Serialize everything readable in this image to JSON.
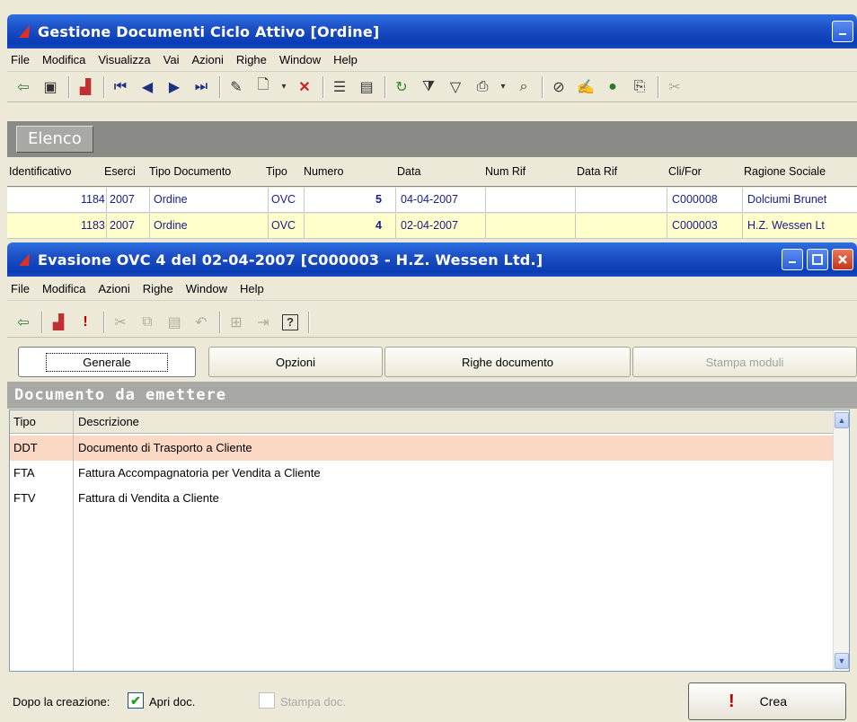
{
  "main": {
    "title": "Gestione Documenti Ciclo Attivo [Ordine]",
    "menu": [
      "File",
      "Modifica",
      "Visualizza",
      "Vai",
      "Azioni",
      "Righe",
      "Window",
      "Help"
    ],
    "elenco_label": "Elenco",
    "columns": [
      "Identificativo",
      "Eserci",
      "Tipo Documento",
      "Tipo",
      "Numero",
      "Data",
      "Num Rif",
      "Data Rif",
      "Cli/For",
      "Ragione Sociale"
    ],
    "rows": [
      {
        "id": "1184",
        "esercizio": "2007",
        "tipo_documento": "Ordine",
        "tipo": "OVC",
        "numero": "5",
        "data": "04-04-2007",
        "num_rif": "",
        "data_rif": "",
        "cli_for": "C000008",
        "ragione_sociale": "Dolciumi Brunet"
      },
      {
        "id": "1183",
        "esercizio": "2007",
        "tipo_documento": "Ordine",
        "tipo": "OVC",
        "numero": "4",
        "data": "02-04-2007",
        "num_rif": "",
        "data_rif": "",
        "cli_for": "C000003",
        "ragione_sociale": "H.Z. Wessen Lt"
      }
    ]
  },
  "dialog": {
    "title": "Evasione OVC 4 del 02-04-2007 [C000003 - H.Z. Wessen Ltd.]",
    "menu": [
      "File",
      "Modifica",
      "Azioni",
      "Righe",
      "Window",
      "Help"
    ],
    "tabs": [
      "Generale",
      "Opzioni",
      "Righe documento",
      "Stampa moduli"
    ],
    "section_title": "Documento da emettere",
    "list_columns": [
      "Tipo",
      "Descrizione"
    ],
    "list_rows": [
      {
        "tipo": "DDT",
        "descrizione": "Documento di Trasporto a Cliente"
      },
      {
        "tipo": "FTA",
        "descrizione": "Fattura Accompagnatoria per Vendita a Cliente"
      },
      {
        "tipo": "FTV",
        "descrizione": "Fattura di Vendita a Cliente"
      }
    ],
    "footer": {
      "label": "Dopo la creazione:",
      "apri_doc": "Apri doc.",
      "stampa_doc": "Stampa doc.",
      "crea": "Crea"
    }
  },
  "colors": {
    "title_blue": "#0a3db5",
    "selection_yellow": "#ffffcc",
    "selection_peach": "#fbd8c4"
  }
}
